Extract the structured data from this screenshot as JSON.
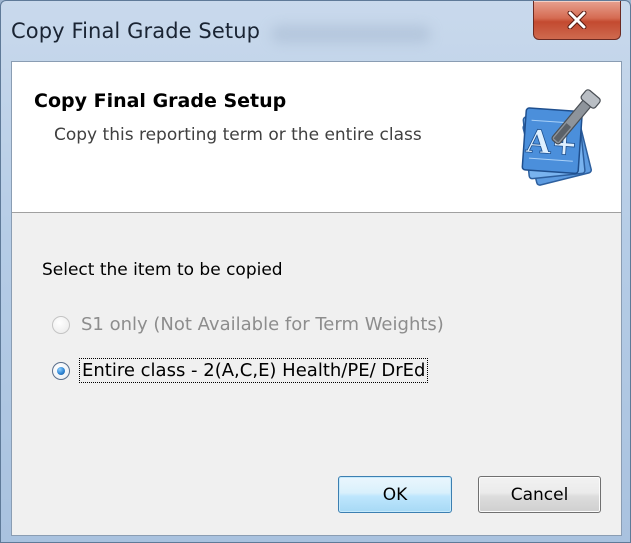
{
  "window": {
    "title": "Copy Final Grade Setup",
    "close_icon": "close-x-icon"
  },
  "header": {
    "title": "Copy Final Grade Setup",
    "subtitle": "Copy this reporting term or the entire class",
    "icon": "grade-setup-tools-icon",
    "icon_letter": "A+"
  },
  "body": {
    "instruction": "Select the item to be copied",
    "options": [
      {
        "label": "S1 only (Not Available for Term Weights)",
        "selected": false,
        "enabled": false
      },
      {
        "label": "Entire class - 2(A,C,E) Health/PE/ DrEd",
        "selected": true,
        "enabled": true
      }
    ]
  },
  "buttons": {
    "ok_label": "OK",
    "cancel_label": "Cancel"
  },
  "colors": {
    "close_button": "#c94a30",
    "ok_button_border": "#3c7fb1",
    "selected_radio": "#2f86d6",
    "disabled_text": "#8d8d8d"
  }
}
